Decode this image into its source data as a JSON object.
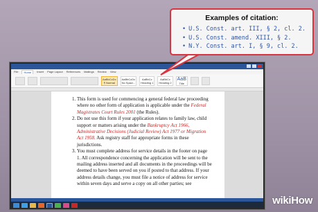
{
  "callout": {
    "title": "Examples of citation:",
    "items": [
      "U.S. Const. art. III, § 2, cl. 2.",
      "U.S. Const. amend. XIII, § 2.",
      "N.Y. Const. art. I, § 9, cl. 2."
    ]
  },
  "document": {
    "item1_a": "This form is used for commencing a general federal law proceeding where no other form of application is applicable under the ",
    "item1_red": "Federal Magistrates Court Rules 2001",
    "item1_b": " (the Rules).",
    "item2_a": "Do not use this form if your application relates to family law, child support or matters arising under the ",
    "item2_red": "Bankruptcy Act 1966, Administrative Decisions (Judicial Review) Act 1977 or Migration Act 1958.",
    "item2_b": " Ask registry staff for appropriate forms in these jurisdictions.",
    "item3": "You must complete address for service details in the footer on page 1. All correspondence concerning the application will be sent to the mailing address inserted and all documents in the proceedings will be deemed to have been served on you if posted to that address. If your address details change, you must file a notice of address for service within seven days and serve a copy on all other parties; see"
  },
  "word": {
    "tabs": [
      "File",
      "Home",
      "Insert",
      "Page Layout",
      "References",
      "Mailings",
      "Review",
      "View"
    ],
    "styles": [
      {
        "sample": "AaBbCcDc",
        "name": "¶ Normal"
      },
      {
        "sample": "AaBbCcDc",
        "name": "No Spaci..."
      },
      {
        "sample": "AaBbCc",
        "name": "Heading 1"
      },
      {
        "sample": "AaBbCc",
        "name": "Heading 2"
      },
      {
        "sample": "AaB",
        "name": "Title"
      }
    ]
  },
  "taskbar_icons": [
    "start-icon",
    "internet-explorer-icon",
    "folder-icon",
    "media-player-icon",
    "word-icon",
    "chrome-icon",
    "paint-icon",
    "acrobat-icon"
  ],
  "watermark": {
    "wiki": "wiki",
    "how": "How"
  },
  "colors": {
    "callout_border": "#d8343f",
    "callout_list": "#2f56a8",
    "red_text": "#cf1f1f",
    "word_blue": "#2b579a"
  }
}
